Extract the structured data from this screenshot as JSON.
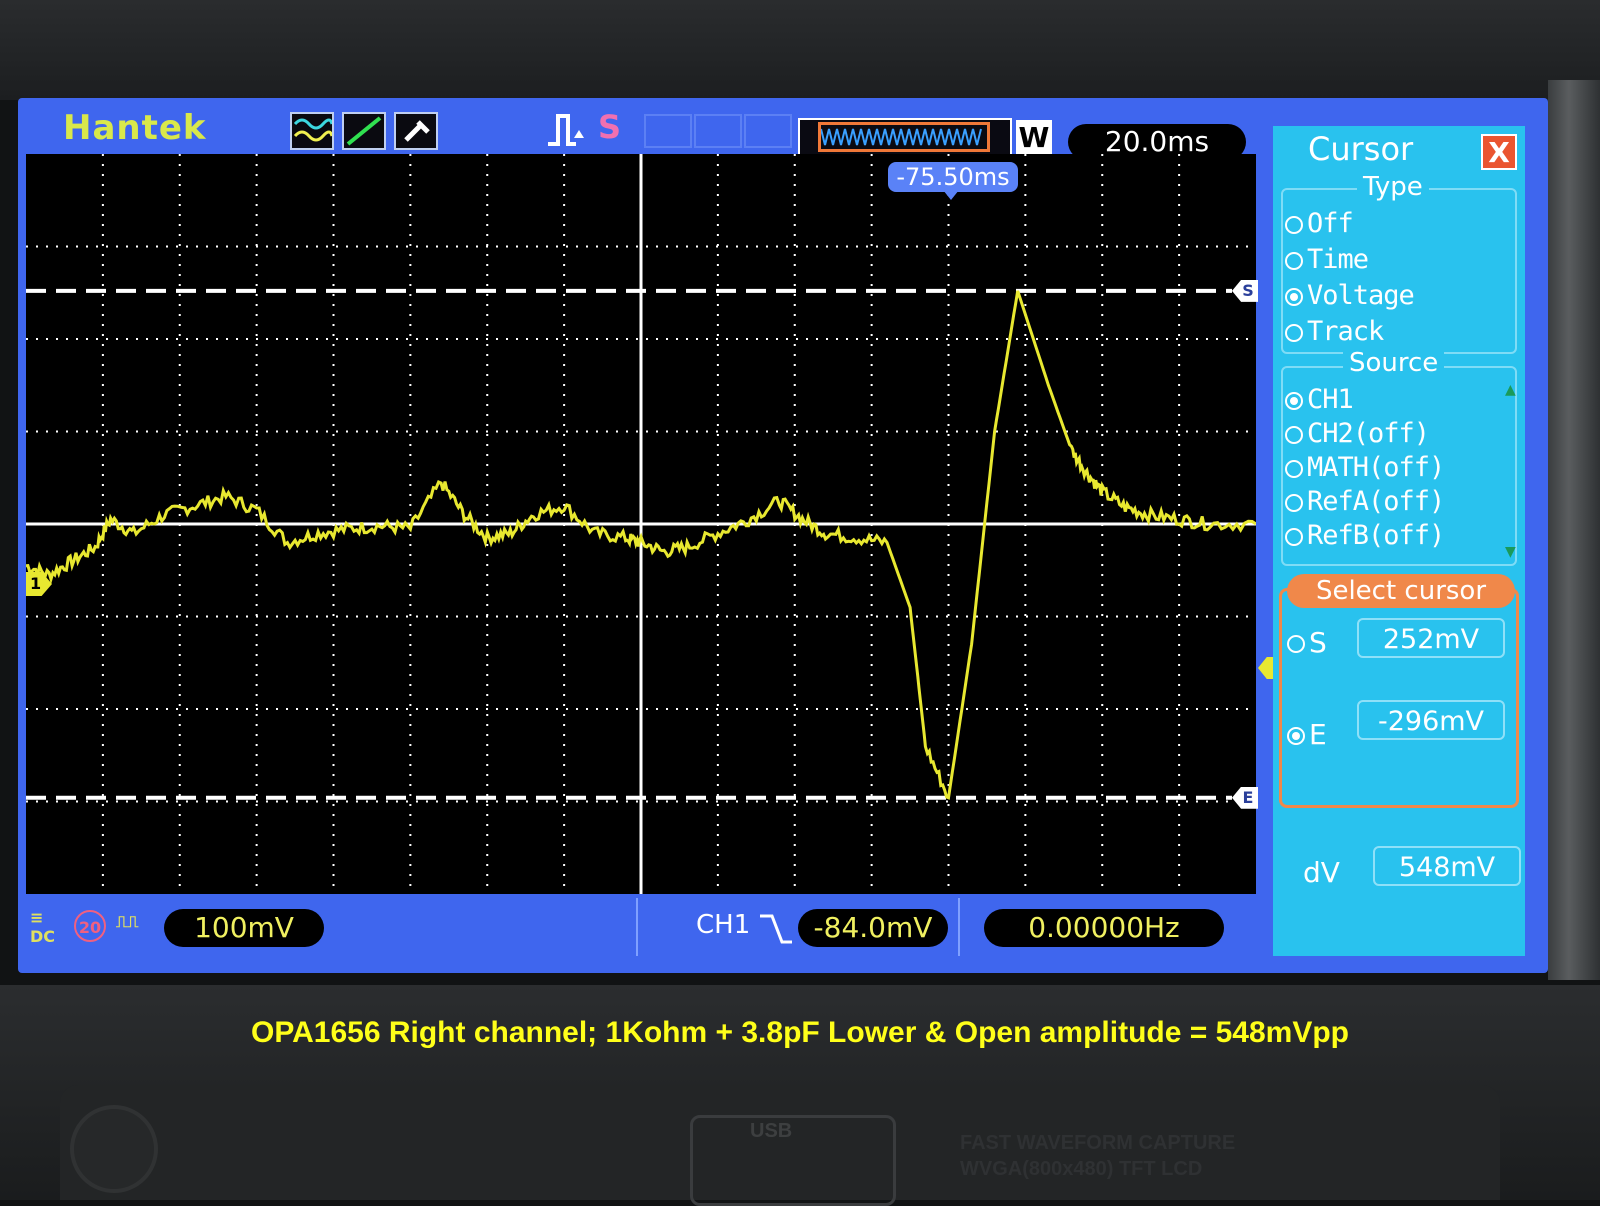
{
  "header": {
    "brand": "Hantek",
    "run_stop": "S",
    "mode_label": "W",
    "timebase": "20.0ms",
    "trigger_position": "-75.50ms"
  },
  "plot": {
    "channel_marker": "1",
    "cursor_s_tag": "S",
    "cursor_e_tag": "E",
    "trace_color": "#e8e830",
    "grid_color": "#ffffff"
  },
  "status": {
    "volts_per_div": "100mV",
    "channel": "CH1",
    "trigger_level": "-84.0mV",
    "frequency": "0.00000Hz",
    "bandwidth_limit": "20"
  },
  "cursor_panel": {
    "title": "Cursor",
    "close": "X",
    "type_label": "Type",
    "type_options": [
      {
        "label": "Off",
        "selected": false
      },
      {
        "label": "Time",
        "selected": false
      },
      {
        "label": "Voltage",
        "selected": true
      },
      {
        "label": "Track",
        "selected": false
      }
    ],
    "source_label": "Source",
    "source_options": [
      {
        "label": "CH1",
        "selected": true
      },
      {
        "label": "CH2(off)",
        "selected": false
      },
      {
        "label": "MATH(off)",
        "selected": false
      },
      {
        "label": "RefA(off)",
        "selected": false
      },
      {
        "label": "RefB(off)",
        "selected": false
      }
    ],
    "select_cursor_label": "Select cursor",
    "s_label": "S",
    "s_value": "252mV",
    "e_label": "E",
    "e_value": "-296mV",
    "dv_label": "dV",
    "dv_value": "548mV"
  },
  "caption": "OPA1656 Right channel; 1Kohm + 3.8pF  Lower & Open amplitude = 548mVpp",
  "device_panel": {
    "usb": "USB",
    "line1": "FAST WAVEFORM CAPTURE",
    "line2": "WVGA(800x480) TFT LCD"
  },
  "chart_data": {
    "type": "line",
    "xlabel": "",
    "ylabel": "",
    "units": {
      "x": "div",
      "y": "mV"
    },
    "xlim": [
      0,
      16
    ],
    "ylim": [
      -400,
      400
    ],
    "volts_per_div": 100,
    "cursors_mV": {
      "S": 252,
      "E": -296
    },
    "series": [
      {
        "name": "CH1",
        "x": [
          0,
          0.3,
          0.6,
          0.9,
          1.1,
          1.4,
          1.8,
          2.2,
          2.6,
          3.0,
          3.4,
          3.8,
          4.2,
          4.6,
          5.0,
          5.4,
          5.7,
          6.0,
          6.3,
          6.6,
          7.0,
          7.4,
          7.8,
          8.0,
          8.3,
          8.6,
          9.0,
          9.4,
          9.8,
          10.1,
          10.4,
          10.8,
          11.2,
          11.5,
          11.7,
          12.0,
          12.3,
          12.6,
          12.9,
          13.3,
          13.6,
          13.8,
          14.0,
          14.3,
          14.6,
          15.0,
          15.4,
          16.0
        ],
        "y": [
          -45,
          -55,
          -40,
          -25,
          5,
          -10,
          10,
          20,
          30,
          15,
          -20,
          -10,
          -5,
          -2,
          -5,
          45,
          10,
          -15,
          -10,
          10,
          20,
          -10,
          -15,
          -20,
          -30,
          -25,
          -10,
          5,
          25,
          5,
          -10,
          -15,
          -20,
          -90,
          -240,
          -296,
          -130,
          100,
          252,
          150,
          80,
          55,
          35,
          18,
          10,
          5,
          0,
          0
        ]
      }
    ]
  }
}
